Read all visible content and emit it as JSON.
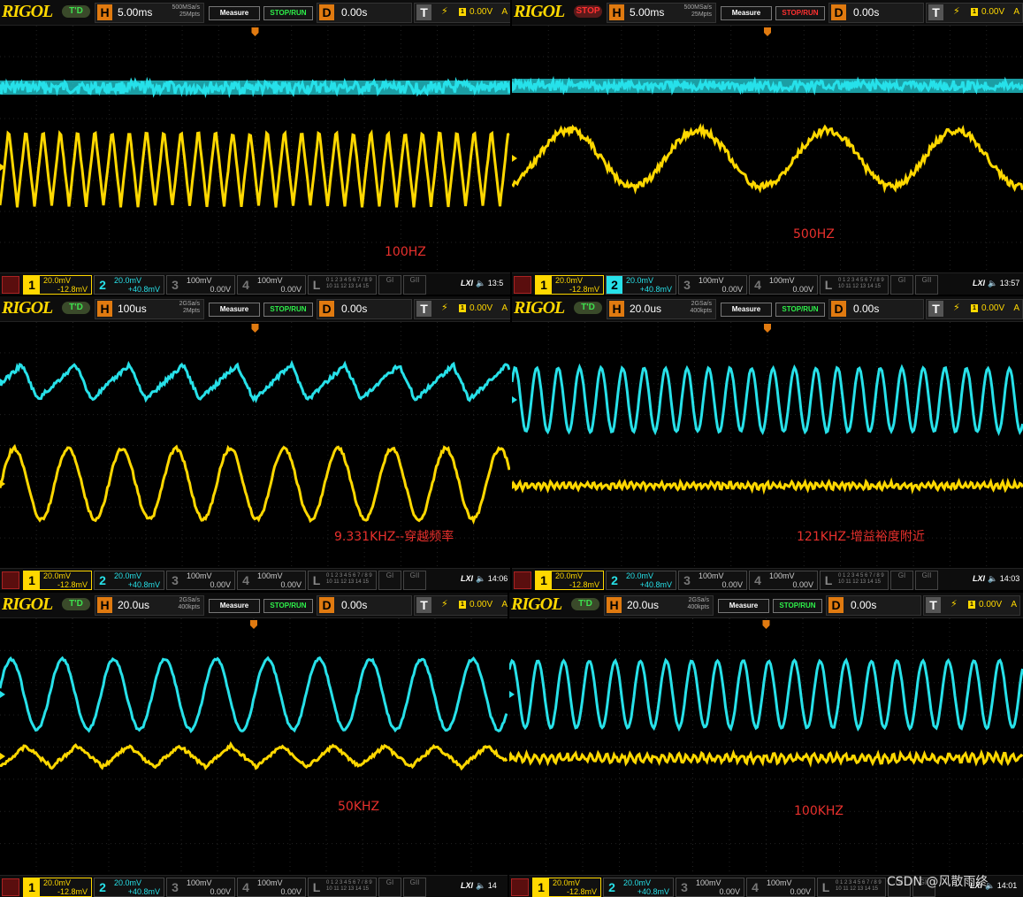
{
  "colors": {
    "ch1": "#ffd800",
    "ch2": "#27e1e9",
    "annotation": "#e8302c",
    "accent": "#e07a10"
  },
  "panels": [
    {
      "logo": "RIGOL",
      "status": "T'D",
      "h_label": "H",
      "timebase": "5.00ms",
      "sample_rate": "500MSa/s",
      "memory": "25Mpts",
      "measure": "Measure",
      "stop_run": "STOP/RUN",
      "d_label": "D",
      "delay": "0.00s",
      "t_label": "T",
      "trigger_source": "1",
      "trigger_level": "0.00V",
      "trigger_unit": "A",
      "ch1_scale": "20.0mV",
      "ch1_offset": "-12.8mV",
      "ch2_scale": "20.0mV",
      "ch2_offset": "+40.8mV",
      "ch3_scale": "100mV",
      "ch3_offset": "0.00V",
      "ch4_scale": "100mV",
      "ch4_offset": "0.00V",
      "la_bits": "0 1 2 3 4 5 6 7 / 8 9 10 11 12 13 14 15",
      "g1": "GI",
      "g2": "GII",
      "lxi": "LXI",
      "clock": "13:5",
      "annotation": "100HZ"
    },
    {
      "logo": "RIGOL",
      "status": "STOP",
      "h_label": "H",
      "timebase": "5.00ms",
      "sample_rate": "500MSa/s",
      "memory": "25Mpts",
      "measure": "Measure",
      "stop_run": "STOP/RUN",
      "d_label": "D",
      "delay": "0.00s",
      "t_label": "T",
      "trigger_source": "1",
      "trigger_level": "0.00V",
      "trigger_unit": "A",
      "ch1_scale": "20.0mV",
      "ch1_offset": "-12.8mV",
      "ch2_scale": "20.0mV",
      "ch2_offset": "+40.8mV",
      "ch3_scale": "100mV",
      "ch3_offset": "0.00V",
      "ch4_scale": "100mV",
      "ch4_offset": "0.00V",
      "la_bits": "0 1 2 3 4 5 6 7 / 8 9 10 11 12 13 14 15",
      "g1": "GI",
      "g2": "GII",
      "lxi": "LXI",
      "clock": "13:57",
      "annotation": "500HZ"
    },
    {
      "logo": "RIGOL",
      "status": "T'D",
      "h_label": "H",
      "timebase": "100us",
      "sample_rate": "2GSa/s",
      "memory": "2Mpts",
      "measure": "Measure",
      "stop_run": "STOP/RUN",
      "d_label": "D",
      "delay": "0.00s",
      "t_label": "T",
      "trigger_source": "1",
      "trigger_level": "0.00V",
      "trigger_unit": "A",
      "ch1_scale": "20.0mV",
      "ch1_offset": "-12.8mV",
      "ch2_scale": "20.0mV",
      "ch2_offset": "+40.8mV",
      "ch3_scale": "100mV",
      "ch3_offset": "0.00V",
      "ch4_scale": "100mV",
      "ch4_offset": "0.00V",
      "la_bits": "0 1 2 3 4 5 6 7 / 8 9 10 11 12 13 14 15",
      "g1": "GI",
      "g2": "GII",
      "lxi": "LXI",
      "clock": "14:06",
      "annotation": "9.331KHZ--穿越频率"
    },
    {
      "logo": "RIGOL",
      "status": "T'D",
      "h_label": "H",
      "timebase": "20.0us",
      "sample_rate": "2GSa/s",
      "memory": "400kpts",
      "measure": "Measure",
      "stop_run": "STOP/RUN",
      "d_label": "D",
      "delay": "0.00s",
      "t_label": "T",
      "trigger_source": "1",
      "trigger_level": "0.00V",
      "trigger_unit": "A",
      "ch1_scale": "20.0mV",
      "ch1_offset": "-12.8mV",
      "ch2_scale": "20.0mV",
      "ch2_offset": "+40.8mV",
      "ch3_scale": "100mV",
      "ch3_offset": "0.00V",
      "ch4_scale": "100mV",
      "ch4_offset": "0.00V",
      "la_bits": "0 1 2 3 4 5 6 7 / 8 9 10 11 12 13 14 15",
      "g1": "GI",
      "g2": "GII",
      "lxi": "LXI",
      "clock": "14:03",
      "annotation": "121KHZ-增益裕度附近"
    },
    {
      "logo": "RIGOL",
      "status": "T'D",
      "h_label": "H",
      "timebase": "20.0us",
      "sample_rate": "2GSa/s",
      "memory": "400kpts",
      "measure": "Measure",
      "stop_run": "STOP/RUN",
      "d_label": "D",
      "delay": "0.00s",
      "t_label": "T",
      "trigger_source": "1",
      "trigger_level": "0.00V",
      "trigger_unit": "A",
      "ch1_scale": "20.0mV",
      "ch1_offset": "-12.8mV",
      "ch2_scale": "20.0mV",
      "ch2_offset": "+40.8mV",
      "ch3_scale": "100mV",
      "ch3_offset": "0.00V",
      "ch4_scale": "100mV",
      "ch4_offset": "0.00V",
      "la_bits": "0 1 2 3 4 5 6 7 / 8 9 10 11 12 13 14 15",
      "g1": "GI",
      "g2": "GII",
      "lxi": "LXI",
      "clock": "14",
      "annotation": "50KHZ"
    },
    {
      "logo": "RIGOL",
      "status": "T'D",
      "h_label": "H",
      "timebase": "20.0us",
      "sample_rate": "2GSa/s",
      "memory": "400kpts",
      "measure": "Measure",
      "stop_run": "STOP/RUN",
      "d_label": "D",
      "delay": "0.00s",
      "t_label": "T",
      "trigger_source": "1",
      "trigger_level": "0.00V",
      "trigger_unit": "A",
      "ch1_scale": "20.0mV",
      "ch1_offset": "-12.8mV",
      "ch2_scale": "20.0mV",
      "ch2_offset": "+40.8mV",
      "ch3_scale": "100mV",
      "ch3_offset": "0.00V",
      "ch4_scale": "100mV",
      "ch4_offset": "0.00V",
      "la_bits": "0 1 2 3 4 5 6 7 / 8 9 10 11 12 13 14 15",
      "g1": "GI",
      "g2": "GII",
      "lxi": "LXI",
      "clock": "14:01",
      "annotation": "100KHZ"
    }
  ],
  "watermark": "CSDN @风散雨终"
}
